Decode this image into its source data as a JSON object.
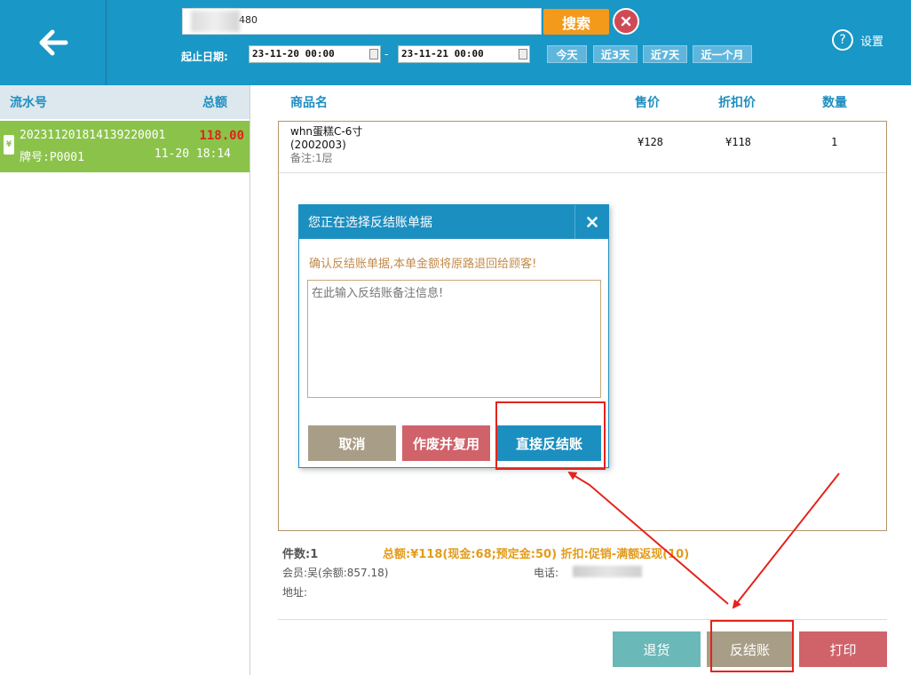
{
  "topbar": {
    "search_value": "480",
    "search_button": "搜索",
    "date_label": "起止日期:",
    "date_start": "23-11-20 00:00",
    "date_end": "23-11-21 00:00",
    "date_dash": "-",
    "ranges": [
      "今天",
      "近3天",
      "近7天",
      "近一个月"
    ],
    "settings_label": "设置"
  },
  "left": {
    "col_serial": "流水号",
    "col_total": "总额",
    "order": {
      "serial": "20231120181413922000​1",
      "amount": "118.00",
      "plate": "牌号:P0001",
      "time": "11-20 18:14",
      "tag": "¥"
    }
  },
  "goods": {
    "headers": {
      "name": "商品名",
      "price": "售价",
      "discount": "折扣价",
      "qty": "数量"
    },
    "item": {
      "name": "whn蛋糕C-6寸",
      "code": "(2002003)",
      "note": "备注:1层",
      "price": "¥128",
      "discount": "¥118",
      "qty": "1"
    }
  },
  "summary": {
    "count": "件数:1",
    "total": "总额:¥118(现金:68;预定金:50)  折扣:促销-满额返现(10)",
    "member": "会员:吴(余额:857.18)",
    "phone_label": "电话:",
    "address_label": "地址:"
  },
  "actions": {
    "return": "退货",
    "reverse": "反结账",
    "print": "打印"
  },
  "modal": {
    "title": "您正在选择反结账单据",
    "message": "确认反结账单据,本单金额将原路退回给顾客!",
    "placeholder": "在此输入反结账备注信息!",
    "cancel": "取消",
    "void_reuse": "作废并复用",
    "direct_reverse": "直接反结账"
  },
  "colors": {
    "topbar": "#1997c6",
    "order_selected": "#8bc34a",
    "search_btn": "#f39a1a",
    "cancel_btn": "#a89d86",
    "void_btn": "#d0626a",
    "direct_btn": "#1c8fc1",
    "return_btn": "#6bb8b8",
    "print_btn": "#d0626a",
    "highlight": "#e5231c"
  }
}
